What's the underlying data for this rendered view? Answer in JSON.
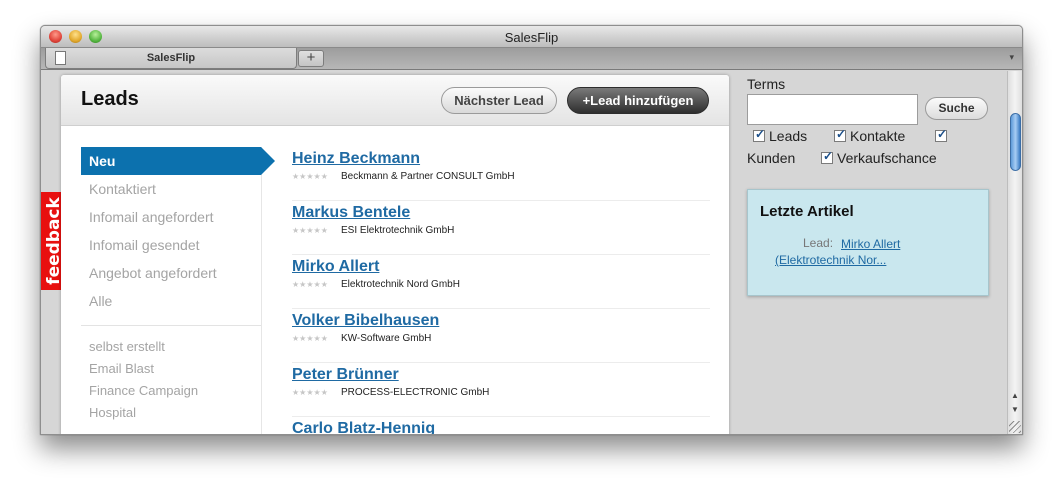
{
  "window": {
    "title": "SalesFlip"
  },
  "tabs": [
    {
      "label": "SalesFlip"
    }
  ],
  "new_tab_label": "+",
  "tab_menu_icon": "chevron-down-icon",
  "feedback": {
    "label": "feedback"
  },
  "header": {
    "title": "Leads",
    "next_label": "Nächster Lead",
    "add_label": "+Lead hinzufügen"
  },
  "nav": {
    "items": [
      {
        "label": "Neu",
        "active": true
      },
      {
        "label": "Kontaktiert"
      },
      {
        "label": "Infomail angefordert"
      },
      {
        "label": "Infomail gesendet"
      },
      {
        "label": "Angebot angefordert"
      },
      {
        "label": "Alle"
      }
    ],
    "sources": [
      {
        "label": "selbst erstellt"
      },
      {
        "label": "Email Blast"
      },
      {
        "label": "Finance Campaign"
      },
      {
        "label": "Hospital"
      }
    ]
  },
  "leads": [
    {
      "name": "Heinz Beckmann",
      "company": "Beckmann & Partner CONSULT GmbH",
      "stars": "★★★★★"
    },
    {
      "name": "Markus Bentele",
      "company": "ESI Elektrotechnik GmbH",
      "stars": "★★★★★"
    },
    {
      "name": "Mirko Allert",
      "company": "Elektrotechnik Nord GmbH",
      "stars": "★★★★★"
    },
    {
      "name": "Volker Bibelhausen",
      "company": "KW-Software GmbH",
      "stars": "★★★★★"
    },
    {
      "name": "Peter Brünner",
      "company": "PROCESS-ELECTRONIC GmbH",
      "stars": "★★★★★"
    },
    {
      "name": "Carlo Blatz-Hennig",
      "company": "",
      "stars": ""
    }
  ],
  "search": {
    "label": "Terms",
    "value": "",
    "button_label": "Suche",
    "filters": [
      {
        "label": "Leads",
        "checked": true
      },
      {
        "label": "Kontakte",
        "checked": true
      },
      {
        "label": "Kunden",
        "checked": true
      },
      {
        "label": "Verkaufschance",
        "checked": true
      }
    ]
  },
  "recent": {
    "title": "Letzte Artikel",
    "items": [
      {
        "kind": "Lead:",
        "label": "Mirko Allert (Elektrotechnik Nor..."
      }
    ]
  },
  "colors": {
    "accent": "#0c71ae",
    "link": "#1f6aa3",
    "feedback": "#e8100f",
    "recent_bg": "#c9e7ee"
  }
}
